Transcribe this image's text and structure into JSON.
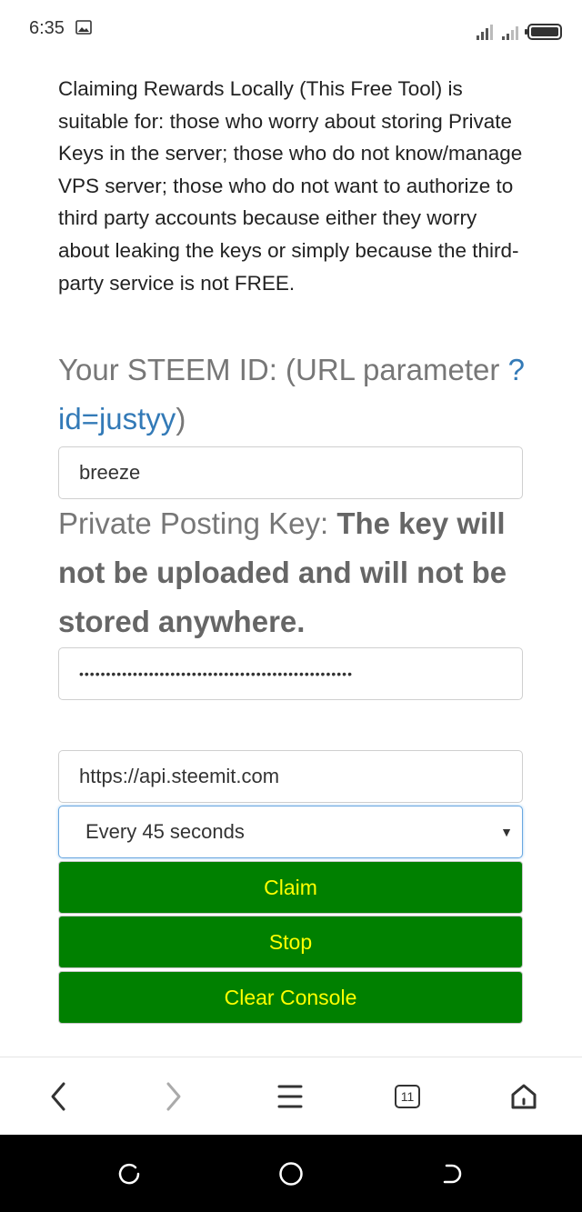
{
  "status": {
    "time": "6:35"
  },
  "intro": "Claiming Rewards Locally (This Free Tool) is suitable for: those who worry about storing Private Keys in the server; those who do not know/manage VPS server; those who do not want to authorize to third party accounts because either they worry about leaking the keys or simply because the third-party service is not FREE.",
  "steem_id": {
    "label": "Your STEEM ID: (URL parameter ",
    "link": "?id=justyy",
    "suffix": ")",
    "value": "breeze"
  },
  "private_key": {
    "label": "Private Posting Key: ",
    "bold": "The key will not be uploaded and will not be stored anywhere.",
    "masked": "•••••••••••••••••••••••••••••••••••••••••••••••••••"
  },
  "api_node": "https://api.steemit.com",
  "interval": {
    "selected": "Every 45 seconds"
  },
  "buttons": {
    "claim": "Claim",
    "stop": "Stop",
    "clear": "Clear Console"
  },
  "browser": {
    "tab_count": "11"
  },
  "colors": {
    "button_bg": "#008000",
    "button_text": "#ffff00",
    "link": "#337ab7"
  }
}
